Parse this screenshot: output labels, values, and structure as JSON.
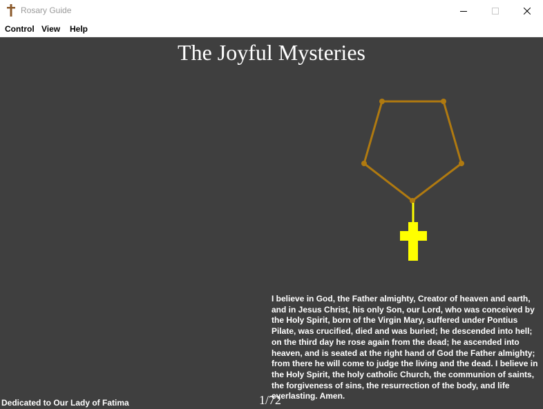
{
  "window": {
    "title": "Rosary Guide",
    "icon": "cross-icon",
    "controls": [
      "minimize-icon",
      "maximize-icon",
      "close-icon"
    ]
  },
  "menu": {
    "items": [
      {
        "label": "Control"
      },
      {
        "label": "View"
      },
      {
        "label": "Help"
      }
    ]
  },
  "main": {
    "mystery_title": "The Joyful Mysteries",
    "prayer_text": "I believe in God, the Father almighty, Creator of heaven and earth, and in Jesus Christ, his only Son, our Lord, who was conceived by the Holy Spirit, born of the Virgin Mary, suffered under Pontius Pilate, was crucified, died and was buried; he descended into hell; on the third day he rose again from the dead; he ascended into heaven, and is seated at the right hand of God the Father almighty; from there he will come to judge the living and the dead. I believe in the Holy Spirit, the holy catholic Church, the communion of saints, the forgiveness of sins, the resurrection of the body, and life everlasting. Amen.",
    "dedication": "Dedicated to Our Lady of Fatima",
    "counter": "1/72"
  },
  "colors": {
    "background": "#3f3f3f",
    "rosary_chain": "#b07a10",
    "active_highlight": "#ffff00",
    "text": "#ffffff"
  }
}
